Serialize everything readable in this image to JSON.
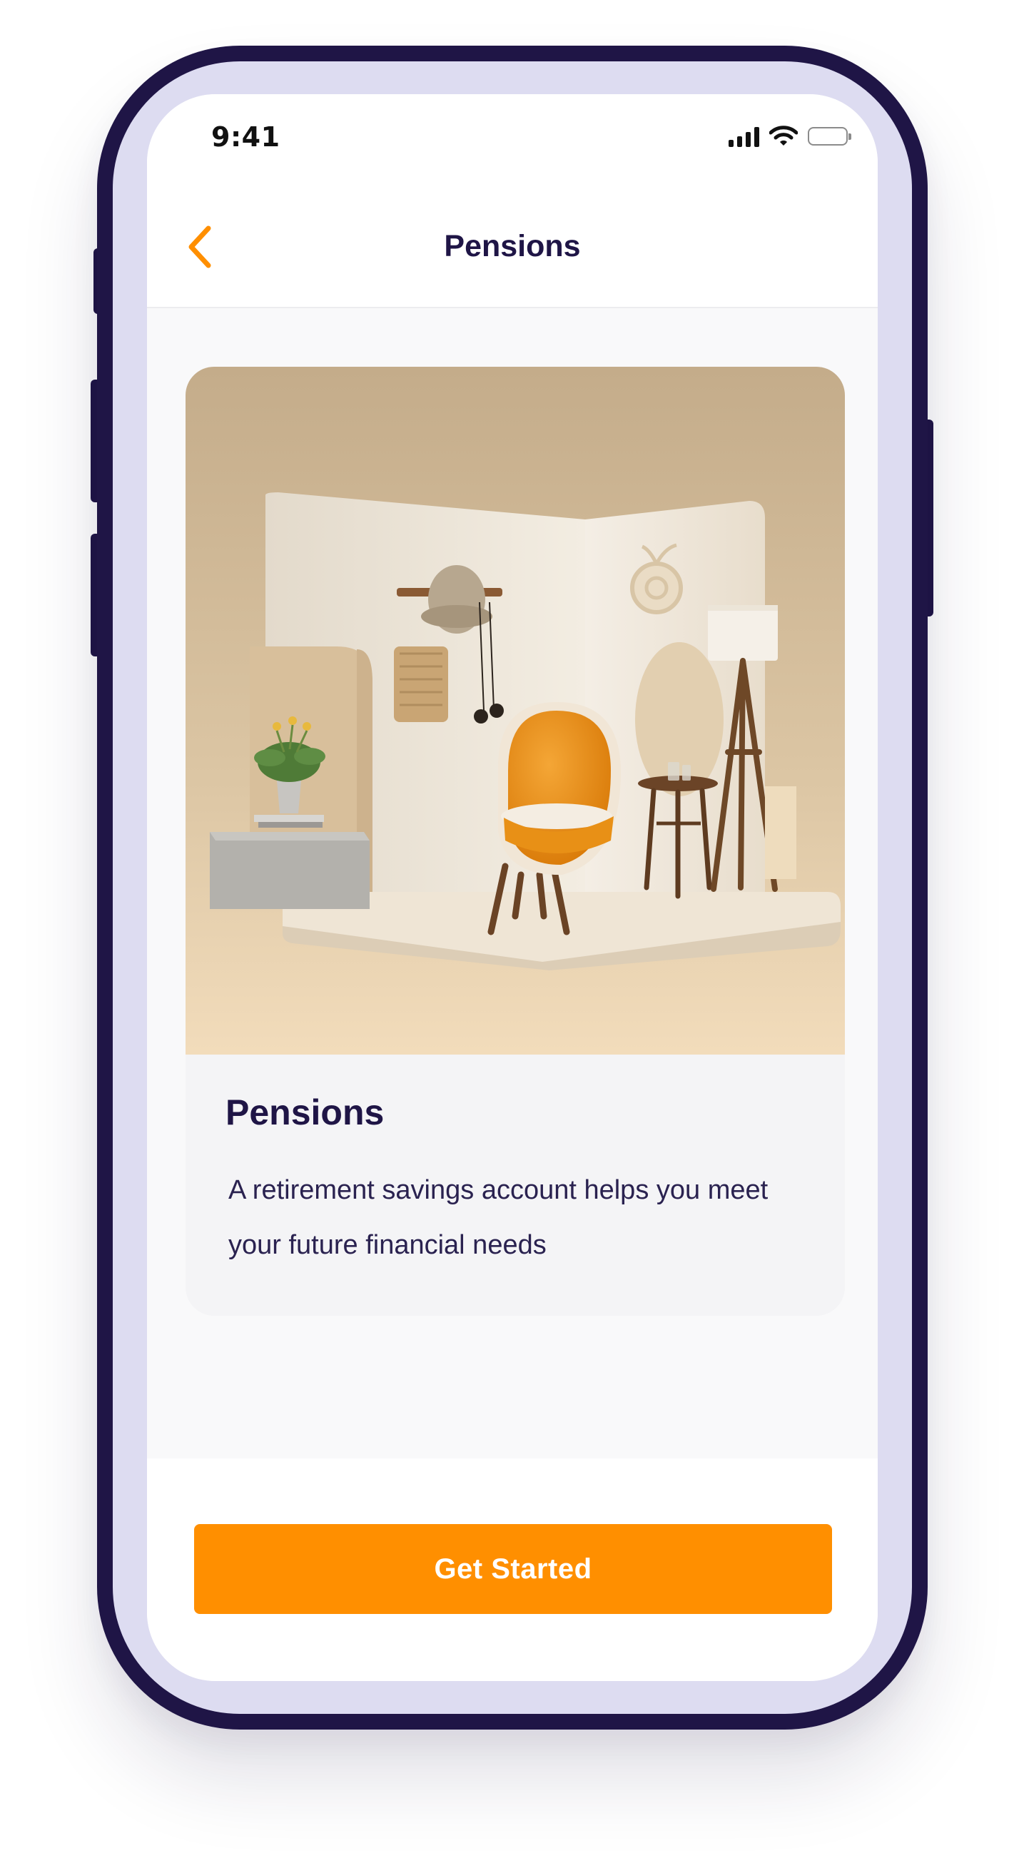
{
  "status_bar": {
    "time": "9:41",
    "icons": [
      "cellular-signal-icon",
      "wifi-icon",
      "battery-icon"
    ]
  },
  "nav": {
    "back_icon": "chevron-left-icon",
    "title": "Pensions"
  },
  "card": {
    "illustration": "retirement-lounge-room-illustration",
    "title": "Pensions",
    "description": "A retirement savings account helps you meet your future financial needs"
  },
  "footer": {
    "cta_label": "Get Started"
  },
  "colors": {
    "accent": "#ff8f00",
    "primary_text": "#1f1546",
    "phone_frame": "#1f1546",
    "phone_bezel": "#dddcf1"
  }
}
